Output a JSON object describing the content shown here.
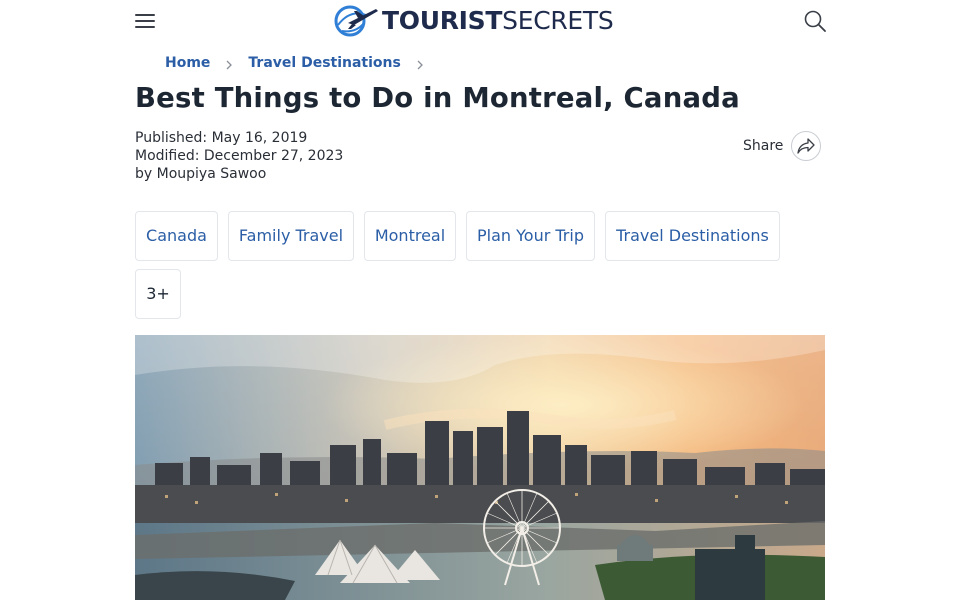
{
  "header": {
    "menu_icon": "hamburger-menu-icon",
    "logo": {
      "brand_bold": "TOURIST",
      "brand_light": "SECRETS",
      "icon": "airplane-globe-icon"
    },
    "search_icon": "search-icon"
  },
  "breadcrumb": [
    {
      "label": "Home"
    },
    {
      "label": "Travel Destinations"
    }
  ],
  "article": {
    "title": "Best Things to Do in Montreal, Canada",
    "published": "Published: May 16, 2019",
    "modified": "Modified: December 27, 2023",
    "author": "by Moupiya Sawoo",
    "share_label": "Share",
    "share_icon": "share-arrow-icon"
  },
  "tags": [
    {
      "label": "Canada"
    },
    {
      "label": "Family Travel"
    },
    {
      "label": "Montreal"
    },
    {
      "label": "Plan Your Trip"
    },
    {
      "label": "Travel Destinations"
    }
  ],
  "more_tags": "3+",
  "hero_image": {
    "subject": "Montreal skyline at sunset with Ferris wheel and Old Port"
  },
  "colors": {
    "link": "#2b5ea6",
    "title": "#1d2733",
    "logo_navy": "#1f2b4c",
    "logo_blue": "#2f7fd6",
    "tag_border": "#e3e6ea"
  }
}
